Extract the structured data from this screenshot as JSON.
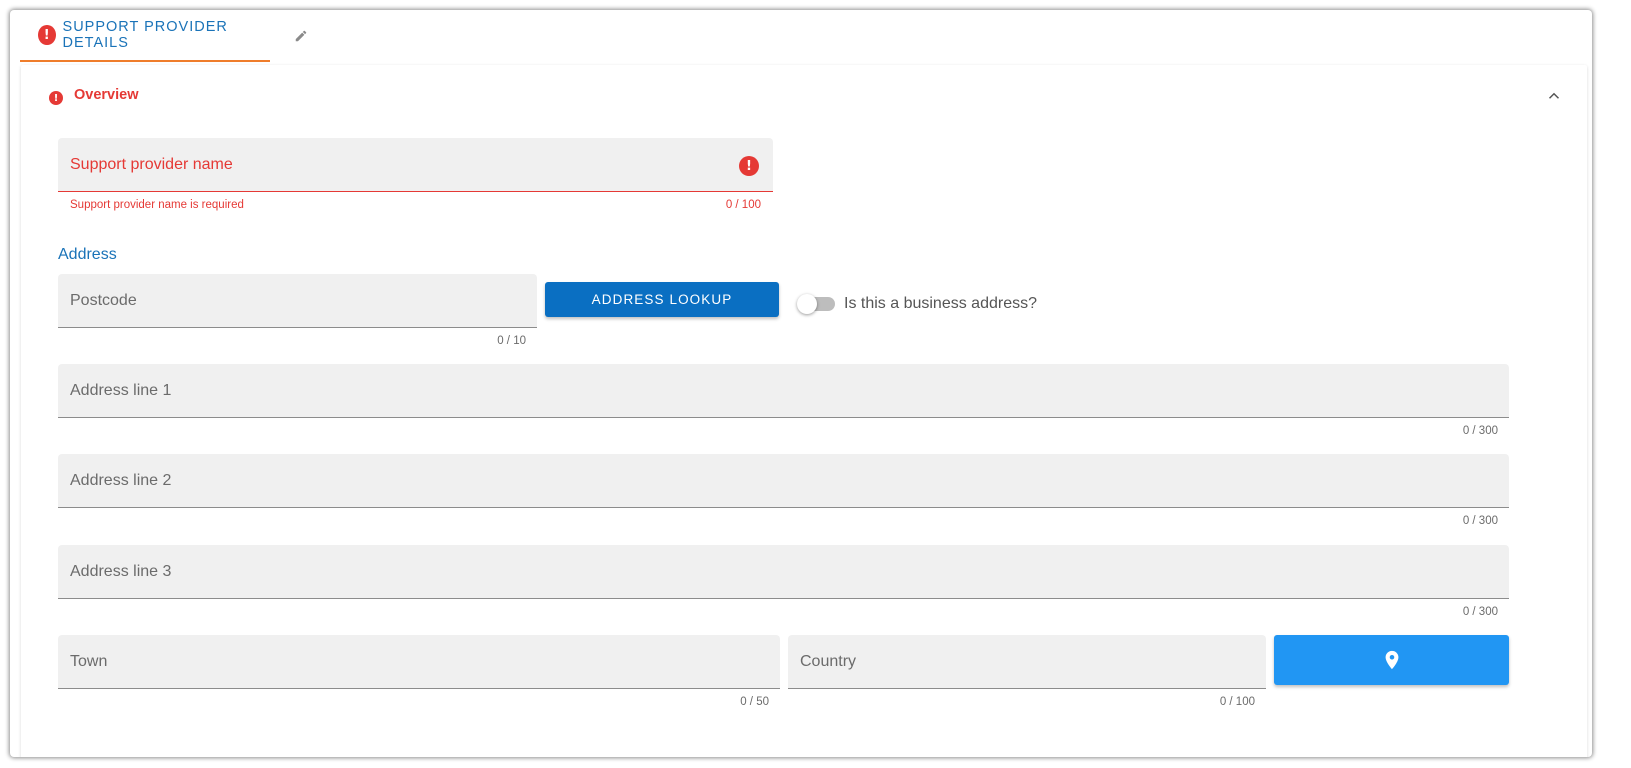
{
  "tab": {
    "label": "SUPPORT PROVIDER DETAILS",
    "error_icon": "!",
    "edit_icon": "pencil-icon"
  },
  "panel": {
    "title": "Overview",
    "error_icon": "!",
    "collapse_icon": "chevron-up-icon"
  },
  "fields": {
    "provider_name": {
      "label": "Support provider name",
      "value": "",
      "helper": "Support provider name is required",
      "counter": "0 / 100",
      "error_icon": "!"
    },
    "address_section": "Address",
    "postcode": {
      "label": "Postcode",
      "value": "",
      "counter": "0 / 10"
    },
    "address_line_1": {
      "label": "Address line 1",
      "value": "",
      "counter": "0 / 300"
    },
    "address_line_2": {
      "label": "Address line 2",
      "value": "",
      "counter": "0 / 300"
    },
    "address_line_3": {
      "label": "Address line 3",
      "value": "",
      "counter": "0 / 300"
    },
    "town": {
      "label": "Town",
      "value": "",
      "counter": "0 / 50"
    },
    "country": {
      "label": "Country",
      "value": "",
      "counter": "0 / 100"
    }
  },
  "buttons": {
    "address_lookup": "ADDRESS LOOKUP",
    "map_icon": "map-pin-icon"
  },
  "toggle": {
    "label": "Is this a business address?",
    "checked": false
  },
  "colors": {
    "primary": "#0a6fc2",
    "accent_blue": "#2196f3",
    "error": "#e53935",
    "tab_indicator": "#ef7d2b",
    "field_bg": "#f0f0f0"
  }
}
